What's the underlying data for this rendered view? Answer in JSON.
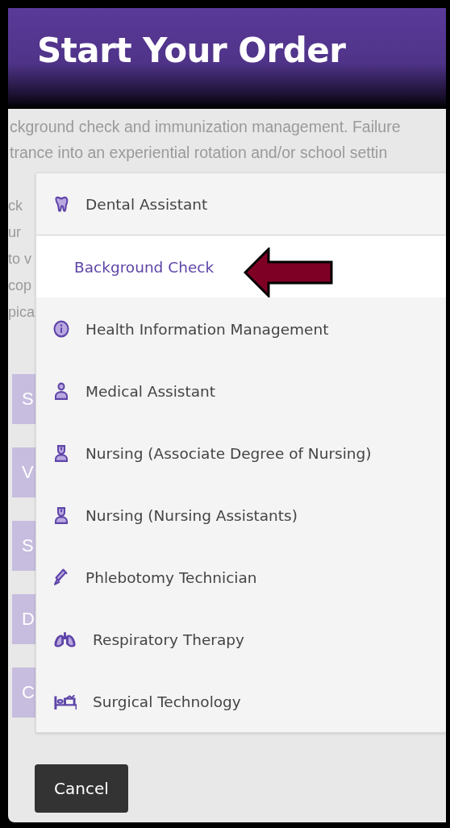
{
  "header": {
    "title": "Start Your Order"
  },
  "background": {
    "text_lines": [
      "ckground check and immunization management. Failure",
      "trance into an experiential rotation and/or school settin"
    ],
    "side_fragments": [
      "ck",
      "ur",
      "to v",
      "cop",
      "pica"
    ],
    "side_buttons": [
      "S",
      "V",
      "S",
      "D",
      "C"
    ]
  },
  "menu": {
    "items": [
      {
        "label": "Dental Assistant",
        "kind": "tooth",
        "expanded": true,
        "children": [
          {
            "label": "Background Check",
            "selected": true
          }
        ]
      },
      {
        "label": "Health Information Management",
        "kind": "info",
        "expanded": false
      },
      {
        "label": "Medical Assistant",
        "kind": "doctor",
        "expanded": false
      },
      {
        "label": "Nursing (Associate Degree of Nursing)",
        "kind": "nurse",
        "expanded": false
      },
      {
        "label": "Nursing (Nursing Assistants)",
        "kind": "nurse",
        "expanded": false
      },
      {
        "label": "Phlebotomy Technician",
        "kind": "syringe",
        "expanded": false
      },
      {
        "label": "Respiratory Therapy",
        "kind": "lungs",
        "expanded": false
      },
      {
        "label": "Surgical Technology",
        "kind": "bed",
        "expanded": false
      }
    ]
  },
  "cancel_button": "Cancel"
}
